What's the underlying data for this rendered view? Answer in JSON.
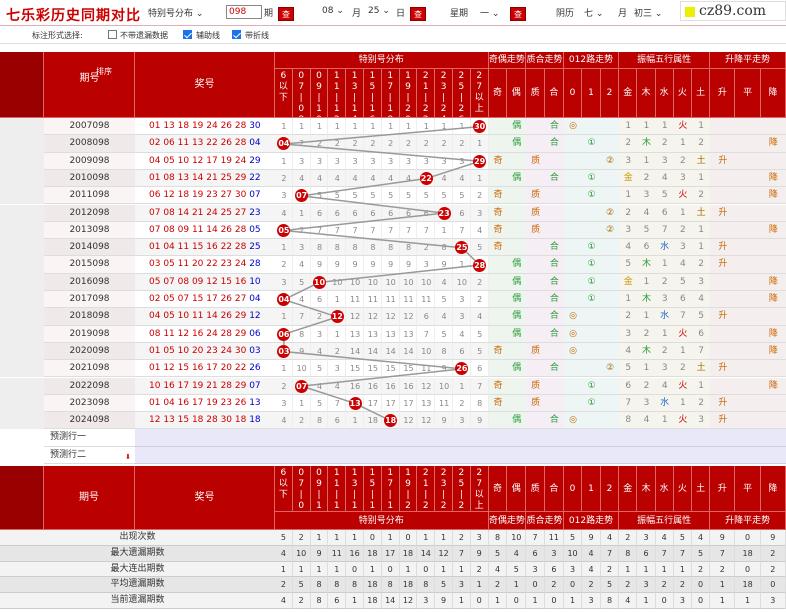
{
  "top": {
    "title": "七乐彩历史同期对比",
    "selector": "特别号分布 ⌄",
    "issue_value": "098",
    "issue_suffix": "期",
    "query": "查",
    "month_value": "08 ⌄",
    "month_label": "月",
    "day_value": "25 ⌄",
    "day_label": "日",
    "weekday_label": "星期",
    "weekday_value": "一 ⌄",
    "lunar_label": "阴历",
    "lunar_month": "七 ⌄",
    "lunar_month_label": "月",
    "lunar_day": "初三 ⌄",
    "logo": "cz89.com"
  },
  "options": {
    "label": "标注形式选择:",
    "opt1": "不带遗漏数据",
    "opt2": "辅助线",
    "opt3": "带折线"
  },
  "header": {
    "issue": "期号",
    "sort": "排序",
    "number": "奖号",
    "special_group": "特别号分布",
    "oe_group": "奇偶走势",
    "pc_group": "质合走势",
    "r012_group": "012路走势",
    "wx_group": "振幅五行属性",
    "ud_group": "升降平走势",
    "special_cols": [
      "6以下",
      "07|08",
      "09|10",
      "11|12",
      "13|14",
      "15|16",
      "17|18",
      "19|20",
      "21|22",
      "23|24",
      "25|26",
      "27以上"
    ],
    "oe_cols": [
      "奇",
      "偶"
    ],
    "pc_cols": [
      "质",
      "合"
    ],
    "r012_cols": [
      "0",
      "1",
      "2"
    ],
    "wx_cols": [
      "金",
      "木",
      "水",
      "火",
      "土"
    ],
    "ud_cols": [
      "升",
      "平",
      "降"
    ]
  },
  "rows": [
    {
      "issue": "2007098",
      "nums": "01 13 18 19 24 26 28",
      "sp": "30",
      "pos": 11,
      "miss": [
        "1",
        "1",
        "1",
        "1",
        "1",
        "1",
        "1",
        "1",
        "1",
        "1",
        "1"
      ],
      "oe": [
        "",
        "偶"
      ],
      "pc": [
        "",
        "合"
      ],
      "r": [
        "◎",
        "",
        ""
      ],
      "wx": [
        "1",
        "1",
        "1",
        "火",
        "1"
      ],
      "ud": [
        "",
        "",
        ""
      ]
    },
    {
      "issue": "2008098",
      "nums": "02 06 11 13 22 26 28",
      "sp": "04",
      "pos": 0,
      "miss": [
        "2",
        "2",
        "2",
        "2",
        "2",
        "2",
        "2",
        "2",
        "2",
        "2",
        "1"
      ],
      "oe": [
        "",
        "偶"
      ],
      "pc": [
        "",
        "合"
      ],
      "r": [
        "",
        "①",
        ""
      ],
      "wx": [
        "2",
        "木",
        "2",
        "1",
        "2"
      ],
      "ud": [
        "",
        "",
        "降"
      ]
    },
    {
      "issue": "2009098",
      "nums": "04 05 10 12 17 19 24",
      "sp": "29",
      "pos": 11,
      "miss": [
        "1",
        "3",
        "3",
        "3",
        "3",
        "3",
        "3",
        "3",
        "3",
        "3",
        "3"
      ],
      "oe": [
        "奇",
        ""
      ],
      "pc": [
        "质",
        ""
      ],
      "r": [
        "",
        "",
        "②"
      ],
      "wx": [
        "3",
        "1",
        "3",
        "2",
        "土"
      ],
      "ud": [
        "升",
        "",
        ""
      ]
    },
    {
      "issue": "2010098",
      "nums": "01 08 13 14 21 25 29",
      "sp": "22",
      "pos": 8,
      "miss": [
        "2",
        "4",
        "4",
        "4",
        "4",
        "4",
        "4",
        "4",
        "4",
        "4",
        "1"
      ],
      "oe": [
        "",
        "偶"
      ],
      "pc": [
        "",
        "合"
      ],
      "r": [
        "",
        "①",
        ""
      ],
      "wx": [
        "金",
        "2",
        "4",
        "3",
        "1"
      ],
      "ud": [
        "",
        "",
        "降"
      ]
    },
    {
      "issue": "2011098",
      "nums": "06 12 18 19 23 27 30",
      "sp": "07",
      "pos": 1,
      "miss": [
        "3",
        "5",
        "5",
        "5",
        "5",
        "5",
        "5",
        "5",
        "5",
        "5",
        "2"
      ],
      "oe": [
        "奇",
        ""
      ],
      "pc": [
        "质",
        ""
      ],
      "r": [
        "",
        "①",
        ""
      ],
      "wx": [
        "1",
        "3",
        "5",
        "火",
        "2"
      ],
      "ud": [
        "",
        "",
        "降"
      ]
    },
    {
      "issue": "2012098",
      "nums": "07 08 14 21 24 25 27",
      "sp": "23",
      "pos": 9,
      "miss": [
        "4",
        "1",
        "6",
        "6",
        "6",
        "6",
        "6",
        "6",
        "6",
        "6",
        "3"
      ],
      "oe": [
        "奇",
        ""
      ],
      "pc": [
        "质",
        ""
      ],
      "r": [
        "",
        "",
        "②"
      ],
      "wx": [
        "2",
        "4",
        "6",
        "1",
        "土"
      ],
      "ud": [
        "升",
        "",
        ""
      ]
    },
    {
      "issue": "2013098",
      "nums": "07 08 09 11 14 26 28",
      "sp": "05",
      "pos": 0,
      "miss": [
        "2",
        "7",
        "7",
        "7",
        "7",
        "7",
        "7",
        "7",
        "1",
        "7",
        "4"
      ],
      "oe": [
        "奇",
        ""
      ],
      "pc": [
        "质",
        ""
      ],
      "r": [
        "",
        "",
        "②"
      ],
      "wx": [
        "3",
        "5",
        "7",
        "2",
        "1"
      ],
      "ud": [
        "",
        "",
        "降"
      ]
    },
    {
      "issue": "2014098",
      "nums": "01 04 11 15 16 22 28",
      "sp": "25",
      "pos": 10,
      "miss": [
        "1",
        "3",
        "8",
        "8",
        "8",
        "8",
        "8",
        "8",
        "2",
        "8",
        "5"
      ],
      "oe": [
        "奇",
        ""
      ],
      "pc": [
        "",
        "合"
      ],
      "r": [
        "",
        "①",
        ""
      ],
      "wx": [
        "4",
        "6",
        "水",
        "3",
        "1"
      ],
      "ud": [
        "升",
        "",
        ""
      ]
    },
    {
      "issue": "2015098",
      "nums": "03 05 11 20 22 23 24",
      "sp": "28",
      "pos": 11,
      "miss": [
        "2",
        "4",
        "9",
        "9",
        "9",
        "9",
        "9",
        "9",
        "3",
        "9",
        "1"
      ],
      "oe": [
        "",
        "偶"
      ],
      "pc": [
        "",
        "合"
      ],
      "r": [
        "",
        "①",
        ""
      ],
      "wx": [
        "5",
        "木",
        "1",
        "4",
        "2"
      ],
      "ud": [
        "升",
        "",
        ""
      ]
    },
    {
      "issue": "2016098",
      "nums": "05 07 08 09 12 15 16",
      "sp": "10",
      "pos": 2,
      "miss": [
        "3",
        "5",
        "10",
        "10",
        "10",
        "10",
        "10",
        "10",
        "4",
        "10",
        "2"
      ],
      "oe": [
        "",
        "偶"
      ],
      "pc": [
        "",
        "合"
      ],
      "r": [
        "",
        "①",
        ""
      ],
      "wx": [
        "金",
        "1",
        "2",
        "5",
        "3"
      ],
      "ud": [
        "",
        "",
        "降"
      ]
    },
    {
      "issue": "2017098",
      "nums": "02 05 07 15 17 26 27",
      "sp": "04",
      "pos": 0,
      "miss": [
        "4",
        "6",
        "1",
        "11",
        "11",
        "11",
        "11",
        "11",
        "5",
        "3",
        "2"
      ],
      "oe": [
        "",
        "偶"
      ],
      "pc": [
        "",
        "合"
      ],
      "r": [
        "",
        "①",
        ""
      ],
      "wx": [
        "1",
        "木",
        "3",
        "6",
        "4"
      ],
      "ud": [
        "",
        "",
        "降"
      ]
    },
    {
      "issue": "2018098",
      "nums": "04 05 10 11 14 26 29",
      "sp": "12",
      "pos": 3,
      "miss": [
        "1",
        "7",
        "2",
        "12",
        "12",
        "12",
        "12",
        "6",
        "4",
        "3",
        "4"
      ],
      "oe": [
        "",
        "偶"
      ],
      "pc": [
        "",
        "合"
      ],
      "r": [
        "◎",
        "",
        ""
      ],
      "wx": [
        "2",
        "1",
        "水",
        "7",
        "5"
      ],
      "ud": [
        "升",
        "",
        ""
      ]
    },
    {
      "issue": "2019098",
      "nums": "08 11 12 16 24 28 29",
      "sp": "06",
      "pos": 0,
      "miss": [
        "8",
        "3",
        "1",
        "13",
        "13",
        "13",
        "13",
        "7",
        "5",
        "4",
        "5"
      ],
      "oe": [
        "",
        "偶"
      ],
      "pc": [
        "",
        "合"
      ],
      "r": [
        "◎",
        "",
        ""
      ],
      "wx": [
        "3",
        "2",
        "1",
        "火",
        "6"
      ],
      "ud": [
        "",
        "",
        "降"
      ]
    },
    {
      "issue": "2020098",
      "nums": "01 05 10 20 23 24 30",
      "sp": "03",
      "pos": 0,
      "miss": [
        "9",
        "4",
        "2",
        "14",
        "14",
        "14",
        "14",
        "10",
        "8",
        "6",
        "5"
      ],
      "oe": [
        "奇",
        ""
      ],
      "pc": [
        "质",
        ""
      ],
      "r": [
        "◎",
        "",
        ""
      ],
      "wx": [
        "4",
        "木",
        "2",
        "1",
        "7"
      ],
      "ud": [
        "",
        "",
        "降"
      ]
    },
    {
      "issue": "2021098",
      "nums": "01 12 15 16 17 20 22",
      "sp": "26",
      "pos": 10,
      "miss": [
        "1",
        "10",
        "5",
        "3",
        "15",
        "15",
        "15",
        "15",
        "11",
        "9",
        "6"
      ],
      "oe": [
        "",
        "偶"
      ],
      "pc": [
        "",
        "合"
      ],
      "r": [
        "",
        "",
        "②"
      ],
      "wx": [
        "5",
        "1",
        "3",
        "2",
        "土"
      ],
      "ud": [
        "升",
        "",
        ""
      ]
    },
    {
      "issue": "2022098",
      "nums": "10 16 17 19 21 28 29",
      "sp": "07",
      "pos": 1,
      "miss": [
        "2",
        "4",
        "4",
        "16",
        "16",
        "16",
        "16",
        "12",
        "10",
        "1",
        "7"
      ],
      "oe": [
        "奇",
        ""
      ],
      "pc": [
        "质",
        ""
      ],
      "r": [
        "",
        "①",
        ""
      ],
      "wx": [
        "6",
        "2",
        "4",
        "火",
        "1"
      ],
      "ud": [
        "",
        "",
        "降"
      ]
    },
    {
      "issue": "2023098",
      "nums": "01 04 16 17 19 23 26",
      "sp": "13",
      "pos": 4,
      "miss": [
        "3",
        "1",
        "5",
        "7",
        "17",
        "17",
        "17",
        "13",
        "11",
        "2",
        "8"
      ],
      "oe": [
        "奇",
        ""
      ],
      "pc": [
        "质",
        ""
      ],
      "r": [
        "",
        "①",
        ""
      ],
      "wx": [
        "7",
        "3",
        "水",
        "1",
        "2"
      ],
      "ud": [
        "升",
        "",
        ""
      ]
    },
    {
      "issue": "2024098",
      "nums": "12 13 15 18 28 30 18",
      "sp": "18",
      "pos": 6,
      "miss": [
        "4",
        "2",
        "8",
        "6",
        "1",
        "18",
        "12",
        "12",
        "9",
        "3",
        "9"
      ],
      "oe": [
        "",
        "偶"
      ],
      "pc": [
        "",
        "合"
      ],
      "r": [
        "◎",
        "",
        ""
      ],
      "wx": [
        "8",
        "4",
        "1",
        "火",
        "3"
      ],
      "ud": [
        "升",
        "",
        ""
      ]
    }
  ],
  "predict": [
    "预测行一",
    "预测行二"
  ],
  "footer": {
    "group_special": "特别号分布",
    "group_oe": "奇偶走势",
    "group_pc": "质合走势",
    "group_r": "012路走势",
    "group_wx": "振幅五行属性",
    "group_ud": "升降平走势",
    "stats": [
      {
        "label": "出现次数",
        "vals": [
          "5",
          "2",
          "1",
          "1",
          "1",
          "0",
          "1",
          "0",
          "1",
          "1",
          "2",
          "3",
          "8",
          "10",
          "7",
          "11",
          "5",
          "9",
          "4",
          "2",
          "3",
          "4",
          "5",
          "4",
          "9",
          "0",
          "9"
        ]
      },
      {
        "label": "最大遗漏期数",
        "vals": [
          "4",
          "10",
          "9",
          "11",
          "16",
          "18",
          "17",
          "18",
          "14",
          "12",
          "7",
          "9",
          "5",
          "4",
          "6",
          "3",
          "10",
          "4",
          "7",
          "8",
          "6",
          "7",
          "7",
          "5",
          "7",
          "18",
          "2"
        ]
      },
      {
        "label": "最大连出期数",
        "vals": [
          "1",
          "1",
          "1",
          "1",
          "0",
          "1",
          "0",
          "1",
          "0",
          "1",
          "1",
          "2",
          "4",
          "5",
          "3",
          "6",
          "3",
          "4",
          "2",
          "1",
          "1",
          "1",
          "1",
          "2",
          "2",
          "0",
          "2"
        ]
      },
      {
        "label": "平均遗漏期数",
        "vals": [
          "2",
          "5",
          "8",
          "8",
          "8",
          "18",
          "8",
          "18",
          "8",
          "5",
          "3",
          "1",
          "2",
          "1",
          "0",
          "2",
          "0",
          "2",
          "5",
          "2",
          "3",
          "2",
          "2",
          "0",
          "1",
          "18",
          "0"
        ]
      },
      {
        "label": "当前遗漏期数",
        "vals": [
          "4",
          "2",
          "8",
          "6",
          "1",
          "18",
          "14",
          "12",
          "3",
          "9",
          "1",
          "0",
          "1",
          "0",
          "1",
          "0",
          "1",
          "3",
          "8",
          "4",
          "1",
          "0",
          "3",
          "0",
          "1",
          "1",
          "3"
        ]
      }
    ]
  }
}
